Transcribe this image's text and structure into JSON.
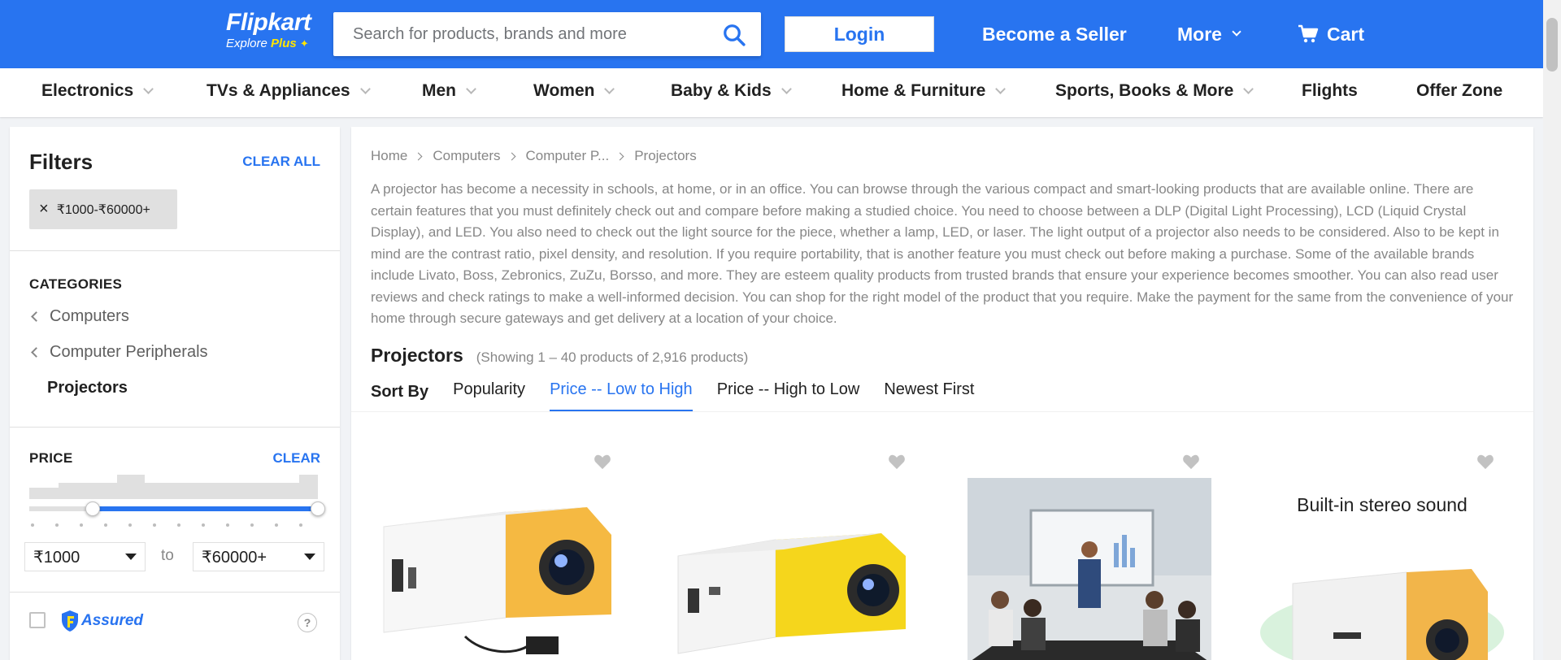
{
  "header": {
    "logo": "Flipkart",
    "logo_sub_prefix": "Explore",
    "logo_sub_plus": "Plus",
    "search_placeholder": "Search for products, brands and more",
    "login": "Login",
    "become_seller": "Become a Seller",
    "more": "More",
    "cart": "Cart",
    "brand_color": "#2874f0"
  },
  "catnav": [
    {
      "label": "Electronics",
      "has_dropdown": true
    },
    {
      "label": "TVs & Appliances",
      "has_dropdown": true
    },
    {
      "label": "Men",
      "has_dropdown": true
    },
    {
      "label": "Women",
      "has_dropdown": true
    },
    {
      "label": "Baby & Kids",
      "has_dropdown": true
    },
    {
      "label": "Home & Furniture",
      "has_dropdown": true
    },
    {
      "label": "Sports, Books & More",
      "has_dropdown": true
    },
    {
      "label": "Flights",
      "has_dropdown": false
    },
    {
      "label": "Offer Zone",
      "has_dropdown": false
    }
  ],
  "sidebar": {
    "title": "Filters",
    "clear_all": "CLEAR ALL",
    "applied_chip": "₹1000-₹60000+",
    "categories_label": "CATEGORIES",
    "category_links": [
      "Computers",
      "Computer Peripherals"
    ],
    "current_category": "Projectors",
    "price_label": "PRICE",
    "price_clear": "CLEAR",
    "price_min": "₹1000",
    "price_to": "to",
    "price_max": "₹60000+",
    "slider_range_fraction": [
      0.22,
      1.0
    ],
    "assured_label": "Assured",
    "help": "?"
  },
  "main": {
    "breadcrumb": [
      "Home",
      "Computers",
      "Computer P...",
      "Projectors"
    ],
    "description": "A projector has become a necessity in schools, at home, or in an office. You can browse through the various compact and smart-looking products that are available online. There are certain features that you must definitely check out and compare before making a studied choice. You need to choose between a DLP (Digital Light Processing), LCD (Liquid Crystal Display), and LED. You also need to check out the light source for the piece, whether a lamp, LED, or laser. The light output of a projector also needs to be considered. Also to be kept in mind are the contrast ratio, pixel density, and resolution. If you require portability, that is another feature you must check out before making a purchase. Some of the available brands include Livato, Boss, Zebronics, ZuZu, Borsso, and more. They are esteem quality products from trusted brands that ensure your experience becomes smoother. You can also read user reviews and check ratings to make a well-informed decision. You can shop for the right model of the product that you require. Make the payment for the same from the convenience of your home through secure gateways and get delivery at a location of your choice.",
    "list_title": "Projectors",
    "showing": "(Showing 1 – 40 products of 2,916 products)",
    "sort_label": "Sort By",
    "sort_options": [
      "Popularity",
      "Price -- Low to High",
      "Price -- High to Low",
      "Newest First"
    ],
    "active_sort": "Price -- Low to High",
    "product_4_banner": "Built-in stereo sound"
  }
}
